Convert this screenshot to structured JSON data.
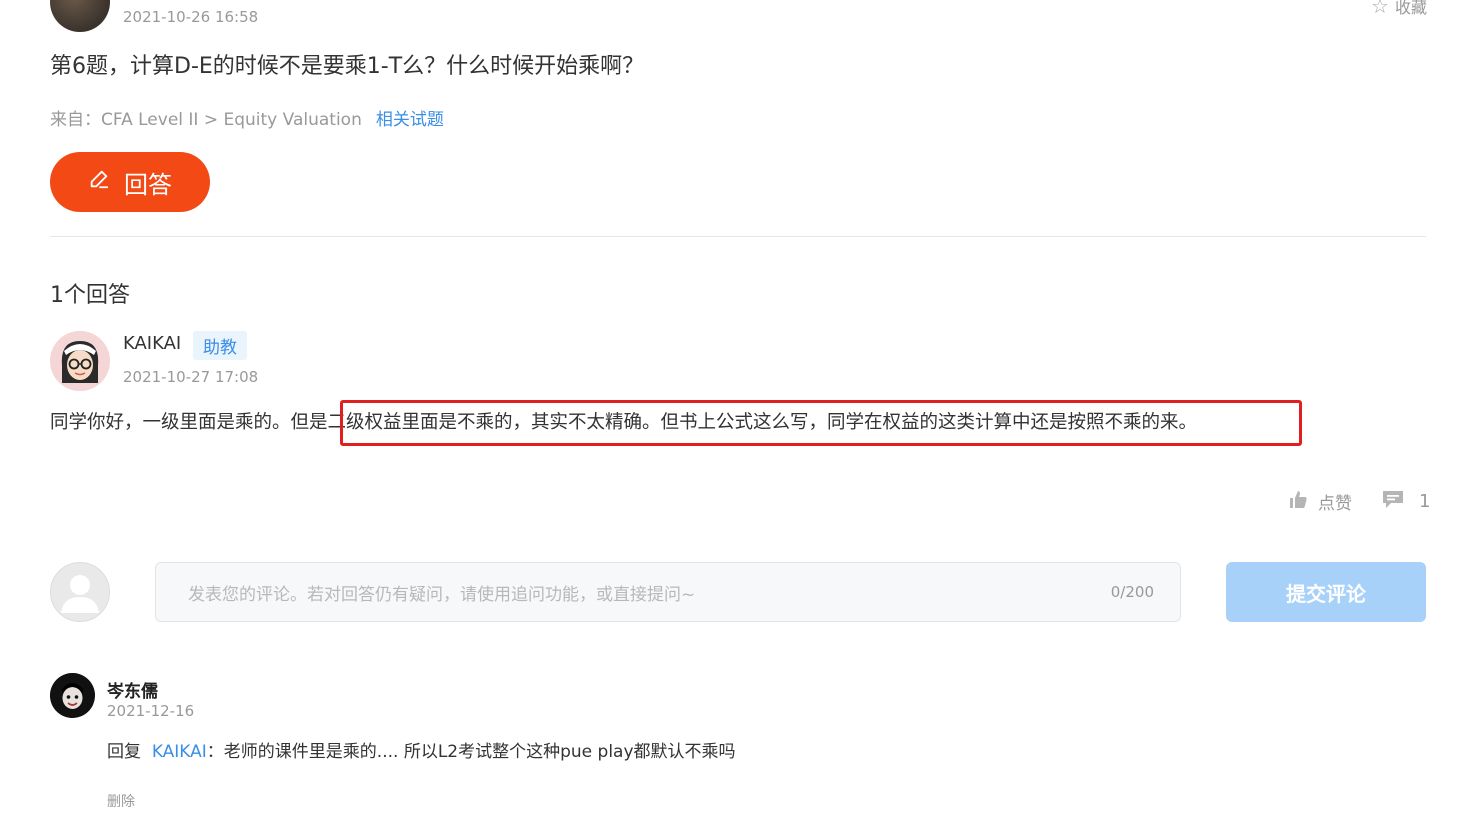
{
  "question": {
    "date": "2021-10-26 16:58",
    "favorite_label": "收藏",
    "title": "第6题，计算D-E的时候不是要乘1-T么？什么时候开始乘啊？",
    "source_prefix": "来自：CFA Level II > Equity Valuation",
    "related_link": "相关试题",
    "answer_button": "回答"
  },
  "answers": {
    "count_label": "1个回答",
    "items": [
      {
        "name": "KAIKAI",
        "badge": "助教",
        "date": "2021-10-27 17:08",
        "text": "同学你好，一级里面是乘的。但是二级权益里面是不乘的，其实不太精确。但书上公式这么写，同学在权益的这类计算中还是按照不乘的来。",
        "like_label": "点赞",
        "comment_count": "1"
      }
    ]
  },
  "comment_box": {
    "placeholder": "发表您的评论。若对回答仍有疑问，请使用追问功能，或直接提问~",
    "counter": "0/200",
    "submit_label": "提交评论"
  },
  "comments": [
    {
      "name": "岑东儒",
      "date": "2021-12-16",
      "reply_prefix": "回复",
      "mention": "KAIKAI",
      "text": "：老师的课件里是乘的.... 所以L2考试整个这种pue play都默认不乘吗",
      "delete_label": "删除"
    }
  ],
  "colors": {
    "accent": "#f24915",
    "link": "#3a8ee6",
    "submit_disabled": "#a7d1f8",
    "highlight_box": "#e02020"
  }
}
